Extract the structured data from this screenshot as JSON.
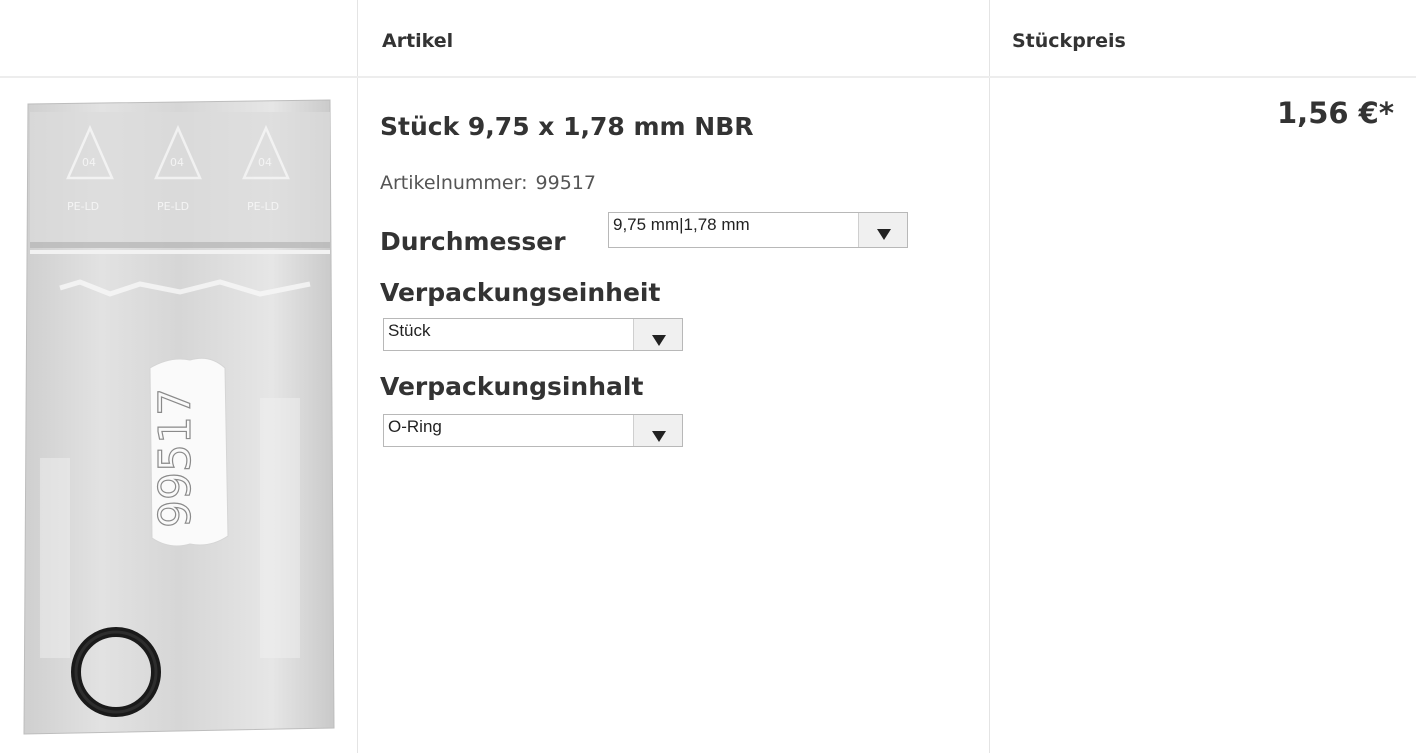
{
  "header": {
    "col_artikel": "Artikel",
    "col_stueckpreis": "Stückpreis"
  },
  "product": {
    "title": "Stück 9,75 x 1,78 mm NBR",
    "artikelnummer_label": "Artikelnummer:",
    "artikelnummer_value": "99517",
    "image": {
      "label_text": "99517",
      "bag_print": [
        "PE-LD",
        "PE-LD",
        "PE-LD"
      ],
      "recycle_code": "04"
    },
    "options": {
      "durchmesser": {
        "label": "Durchmesser",
        "selected": "9,75 mm|1,78 mm"
      },
      "verpackungseinheit": {
        "label": "Verpackungseinheit",
        "selected": "Stück"
      },
      "verpackungsinhalt": {
        "label": "Verpackungsinhalt",
        "selected": "O-Ring"
      }
    },
    "price": "1,56 €*"
  },
  "colors": {
    "grid": "#e4e4e4",
    "text": "#333333",
    "select_border": "#b8b8b8"
  },
  "icons": [
    "chevron-down-icon"
  ]
}
